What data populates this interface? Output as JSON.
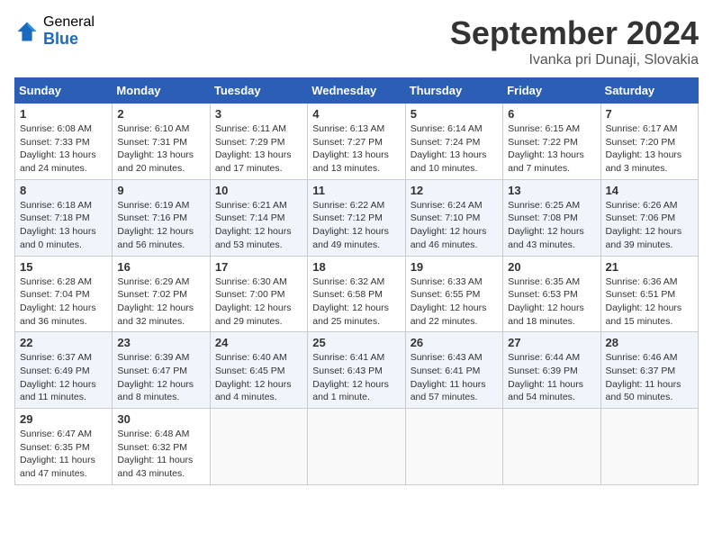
{
  "header": {
    "logo_general": "General",
    "logo_blue": "Blue",
    "month_year": "September 2024",
    "location": "Ivanka pri Dunaji, Slovakia"
  },
  "columns": [
    "Sunday",
    "Monday",
    "Tuesday",
    "Wednesday",
    "Thursday",
    "Friday",
    "Saturday"
  ],
  "weeks": [
    [
      {
        "day": "1",
        "sunrise": "Sunrise: 6:08 AM",
        "sunset": "Sunset: 7:33 PM",
        "daylight": "Daylight: 13 hours and 24 minutes."
      },
      {
        "day": "2",
        "sunrise": "Sunrise: 6:10 AM",
        "sunset": "Sunset: 7:31 PM",
        "daylight": "Daylight: 13 hours and 20 minutes."
      },
      {
        "day": "3",
        "sunrise": "Sunrise: 6:11 AM",
        "sunset": "Sunset: 7:29 PM",
        "daylight": "Daylight: 13 hours and 17 minutes."
      },
      {
        "day": "4",
        "sunrise": "Sunrise: 6:13 AM",
        "sunset": "Sunset: 7:27 PM",
        "daylight": "Daylight: 13 hours and 13 minutes."
      },
      {
        "day": "5",
        "sunrise": "Sunrise: 6:14 AM",
        "sunset": "Sunset: 7:24 PM",
        "daylight": "Daylight: 13 hours and 10 minutes."
      },
      {
        "day": "6",
        "sunrise": "Sunrise: 6:15 AM",
        "sunset": "Sunset: 7:22 PM",
        "daylight": "Daylight: 13 hours and 7 minutes."
      },
      {
        "day": "7",
        "sunrise": "Sunrise: 6:17 AM",
        "sunset": "Sunset: 7:20 PM",
        "daylight": "Daylight: 13 hours and 3 minutes."
      }
    ],
    [
      {
        "day": "8",
        "sunrise": "Sunrise: 6:18 AM",
        "sunset": "Sunset: 7:18 PM",
        "daylight": "Daylight: 13 hours and 0 minutes."
      },
      {
        "day": "9",
        "sunrise": "Sunrise: 6:19 AM",
        "sunset": "Sunset: 7:16 PM",
        "daylight": "Daylight: 12 hours and 56 minutes."
      },
      {
        "day": "10",
        "sunrise": "Sunrise: 6:21 AM",
        "sunset": "Sunset: 7:14 PM",
        "daylight": "Daylight: 12 hours and 53 minutes."
      },
      {
        "day": "11",
        "sunrise": "Sunrise: 6:22 AM",
        "sunset": "Sunset: 7:12 PM",
        "daylight": "Daylight: 12 hours and 49 minutes."
      },
      {
        "day": "12",
        "sunrise": "Sunrise: 6:24 AM",
        "sunset": "Sunset: 7:10 PM",
        "daylight": "Daylight: 12 hours and 46 minutes."
      },
      {
        "day": "13",
        "sunrise": "Sunrise: 6:25 AM",
        "sunset": "Sunset: 7:08 PM",
        "daylight": "Daylight: 12 hours and 43 minutes."
      },
      {
        "day": "14",
        "sunrise": "Sunrise: 6:26 AM",
        "sunset": "Sunset: 7:06 PM",
        "daylight": "Daylight: 12 hours and 39 minutes."
      }
    ],
    [
      {
        "day": "15",
        "sunrise": "Sunrise: 6:28 AM",
        "sunset": "Sunset: 7:04 PM",
        "daylight": "Daylight: 12 hours and 36 minutes."
      },
      {
        "day": "16",
        "sunrise": "Sunrise: 6:29 AM",
        "sunset": "Sunset: 7:02 PM",
        "daylight": "Daylight: 12 hours and 32 minutes."
      },
      {
        "day": "17",
        "sunrise": "Sunrise: 6:30 AM",
        "sunset": "Sunset: 7:00 PM",
        "daylight": "Daylight: 12 hours and 29 minutes."
      },
      {
        "day": "18",
        "sunrise": "Sunrise: 6:32 AM",
        "sunset": "Sunset: 6:58 PM",
        "daylight": "Daylight: 12 hours and 25 minutes."
      },
      {
        "day": "19",
        "sunrise": "Sunrise: 6:33 AM",
        "sunset": "Sunset: 6:55 PM",
        "daylight": "Daylight: 12 hours and 22 minutes."
      },
      {
        "day": "20",
        "sunrise": "Sunrise: 6:35 AM",
        "sunset": "Sunset: 6:53 PM",
        "daylight": "Daylight: 12 hours and 18 minutes."
      },
      {
        "day": "21",
        "sunrise": "Sunrise: 6:36 AM",
        "sunset": "Sunset: 6:51 PM",
        "daylight": "Daylight: 12 hours and 15 minutes."
      }
    ],
    [
      {
        "day": "22",
        "sunrise": "Sunrise: 6:37 AM",
        "sunset": "Sunset: 6:49 PM",
        "daylight": "Daylight: 12 hours and 11 minutes."
      },
      {
        "day": "23",
        "sunrise": "Sunrise: 6:39 AM",
        "sunset": "Sunset: 6:47 PM",
        "daylight": "Daylight: 12 hours and 8 minutes."
      },
      {
        "day": "24",
        "sunrise": "Sunrise: 6:40 AM",
        "sunset": "Sunset: 6:45 PM",
        "daylight": "Daylight: 12 hours and 4 minutes."
      },
      {
        "day": "25",
        "sunrise": "Sunrise: 6:41 AM",
        "sunset": "Sunset: 6:43 PM",
        "daylight": "Daylight: 12 hours and 1 minute."
      },
      {
        "day": "26",
        "sunrise": "Sunrise: 6:43 AM",
        "sunset": "Sunset: 6:41 PM",
        "daylight": "Daylight: 11 hours and 57 minutes."
      },
      {
        "day": "27",
        "sunrise": "Sunrise: 6:44 AM",
        "sunset": "Sunset: 6:39 PM",
        "daylight": "Daylight: 11 hours and 54 minutes."
      },
      {
        "day": "28",
        "sunrise": "Sunrise: 6:46 AM",
        "sunset": "Sunset: 6:37 PM",
        "daylight": "Daylight: 11 hours and 50 minutes."
      }
    ],
    [
      {
        "day": "29",
        "sunrise": "Sunrise: 6:47 AM",
        "sunset": "Sunset: 6:35 PM",
        "daylight": "Daylight: 11 hours and 47 minutes."
      },
      {
        "day": "30",
        "sunrise": "Sunrise: 6:48 AM",
        "sunset": "Sunset: 6:32 PM",
        "daylight": "Daylight: 11 hours and 43 minutes."
      },
      null,
      null,
      null,
      null,
      null
    ]
  ]
}
